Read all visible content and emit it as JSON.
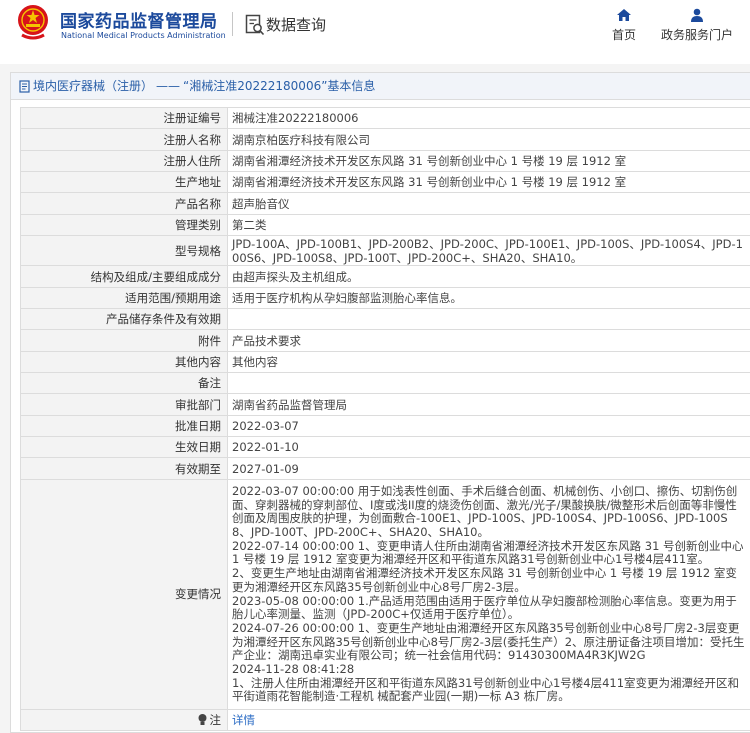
{
  "header": {
    "site_title": "国家药品监督管理局",
    "site_subtitle": "National Medical Products Administration",
    "query_label": "数据查询",
    "nav": [
      {
        "label": "首页",
        "icon": "home-icon"
      },
      {
        "label": "政务服务门户",
        "icon": "user-icon"
      }
    ],
    "brand_color": "#1c4a9c",
    "emblem_color": "#d7141a"
  },
  "breadcrumb": {
    "section": "境内医疗器械（注册）",
    "separator": "——",
    "current": "“湘械注准20222180006”基本信息"
  },
  "record": {
    "rows": [
      {
        "label": "注册证编号",
        "value": "湘械注准20222180006"
      },
      {
        "label": "注册人名称",
        "value": "湖南京柏医疗科技有限公司"
      },
      {
        "label": "注册人住所",
        "value": "湖南省湘潭经济技术开发区东风路 31 号创新创业中心 1 号楼 19 层 1912 室"
      },
      {
        "label": "生产地址",
        "value": "湖南省湘潭经济技术开发区东风路 31 号创新创业中心 1 号楼 19 层 1912 室"
      },
      {
        "label": "产品名称",
        "value": "超声胎音仪"
      },
      {
        "label": "管理类别",
        "value": "第二类"
      },
      {
        "label": "型号规格",
        "value": "JPD-100A、JPD-100B1、JPD-200B2、JPD-200C、JPD-100E1、JPD-100S、JPD-100S4、JPD-100S6、JPD-100S8、JPD-100T、JPD-200C+、SHA20、SHA10。"
      },
      {
        "label": "结构及组成/主要组成成分",
        "value": "由超声探头及主机组成。"
      },
      {
        "label": "适用范围/预期用途",
        "value": "适用于医疗机构从孕妇腹部监测胎心率信息。"
      },
      {
        "label": "产品储存条件及有效期",
        "value": ""
      },
      {
        "label": "附件",
        "value": "产品技术要求"
      },
      {
        "label": "其他内容",
        "value": "其他内容"
      },
      {
        "label": "备注",
        "value": ""
      },
      {
        "label": "审批部门",
        "value": "湖南省药品监督管理局"
      },
      {
        "label": "批准日期",
        "value": "2022-03-07"
      },
      {
        "label": "生效日期",
        "value": "2022-01-10"
      },
      {
        "label": "有效期至",
        "value": "2027-01-09"
      }
    ],
    "change_label": "变更情况",
    "change_lines": [
      "2022-03-07 00:00:00 用于如浅表性创面、手术后缝合创面、机械创伤、小创口、擦伤、切割伤创面、穿刺器械的穿刺部位、I度或浅II度的烧烫伤创面、激光/光子/果酸换肤/微整形术后创面等非慢性创面及周围皮肤的护理，为创面敷合-100E1、JPD-100S、JPD-100S4、JPD-100S6、JPD-100S8、JPD-100T、JPD-200C+、SHA20、SHA10。",
      "2022-07-14 00:00:00 1、变更申请人住所由湖南省湘潭经济技术开发区东风路 31 号创新创业中心 1 号楼 19 层 1912 室变更为湘潭经开区和平街道东风路31号创新创业中心1号楼4层411室。",
      "2、变更生产地址由湖南省湘潭经济技术开发区东风路 31 号创新创业中心 1 号楼 19 层 1912 室变更为湘潭经开区东风路35号创新创业中心8号厂房2-3层。",
      "2023-05-08 00:00:00 1.产品适用范围由适用于医疗单位从孕妇腹部检测胎心率信息。变更为用于胎儿心率测量、监测（JPD-200C+仅适用于医疗单位）。",
      "2024-07-26 00:00:00 1、变更生产地址由湘潭经开区东风路35号创新创业中心8号厂房2-3层变更为湘潭经开区东风路35号创新创业中心8号厂房2-3层(委托生产）2、原注册证备注项目增加：受托生产企业：湖南迅卓实业有限公司；统一社会信用代码：91430300MA4R3KJW2G",
      "2024-11-28 08:41:28",
      "1、注册人住所由湘潭经开区和平街道东风路31号创新创业中心1号楼4层411室变更为湘潭经开区和平街道雨花智能制造·工程机 械配套产业园(一期)一标 A3 栋厂房。"
    ],
    "note_label": "注",
    "note_link": "详情",
    "link_color": "#2a6bc4"
  }
}
